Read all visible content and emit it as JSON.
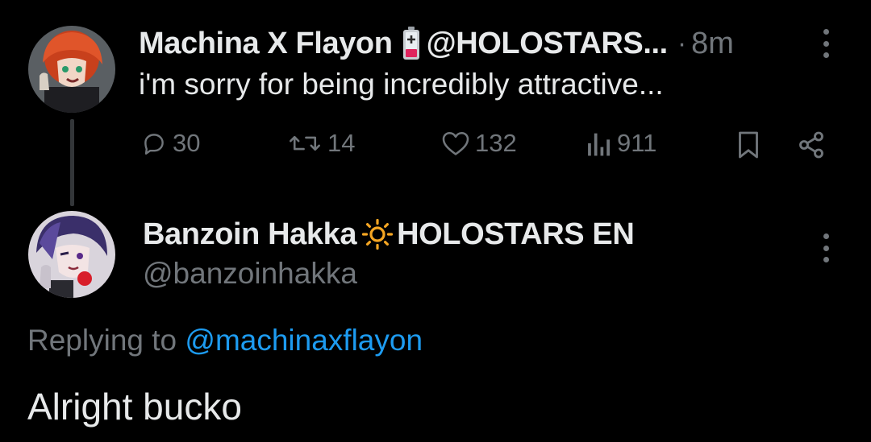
{
  "parent_tweet": {
    "author_name": "Machina X Flayon",
    "author_emoji_icon": "battery-low-icon",
    "author_handle": "@HOLOSTARS...",
    "separator": "·",
    "timestamp": "8m",
    "text": "i'm sorry for being incredibly attractive...",
    "actions": {
      "reply_count": "30",
      "repost_count": "14",
      "like_count": "132",
      "view_count": "911"
    }
  },
  "main_tweet": {
    "author_name": "Banzoin Hakka",
    "author_emoji_icon": "sun-icon",
    "author_name_suffix": "HOLOSTARS EN",
    "author_handle": "@banzoinhakka",
    "replying_to_prefix": "Replying to",
    "replying_to_handle": "@machinaxflayon",
    "text": "Alright bucko"
  },
  "colors": {
    "background": "#000000",
    "primary_text": "#e7e9ea",
    "secondary_text": "#71767b",
    "link": "#1d9bf0",
    "thread_line": "#333639"
  }
}
